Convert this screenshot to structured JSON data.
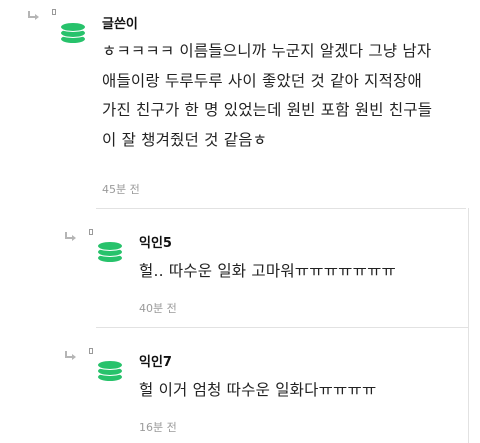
{
  "comments": [
    {
      "author": "글쓴이",
      "text_lines": [
        "ㅎㅋㅋㅋㅋ 이름들으니까 누군지 알겠다 그냥 남자",
        "애들이랑 두루두루 사이 좋았던 것 같아 지적장애",
        "가진 친구가 한 명 있었는데 원빈 포함 원빈 친구들",
        "이 잘 챙겨줬던 것 같음ㅎ"
      ],
      "time": "45분 전",
      "icons": [
        "reply-arrow-icon",
        "avatar-icon"
      ]
    },
    {
      "author": "익인5",
      "text": "헐.. 따수운 일화 고마워ㅠㅠㅠㅠㅠㅠㅠ",
      "time": "40분 전",
      "icons": [
        "reply-arrow-icon",
        "avatar-icon"
      ]
    },
    {
      "author": "익인7",
      "text": "헐 이거 엄청 따수운 일화다ㅠㅠㅠㅠ",
      "time": "16분 전",
      "icons": [
        "reply-arrow-icon",
        "avatar-icon"
      ]
    }
  ],
  "colors": {
    "avatar_green": "#27c26b",
    "text": "#222222",
    "time": "#9b9b9b",
    "divider": "#e2e2e2"
  }
}
